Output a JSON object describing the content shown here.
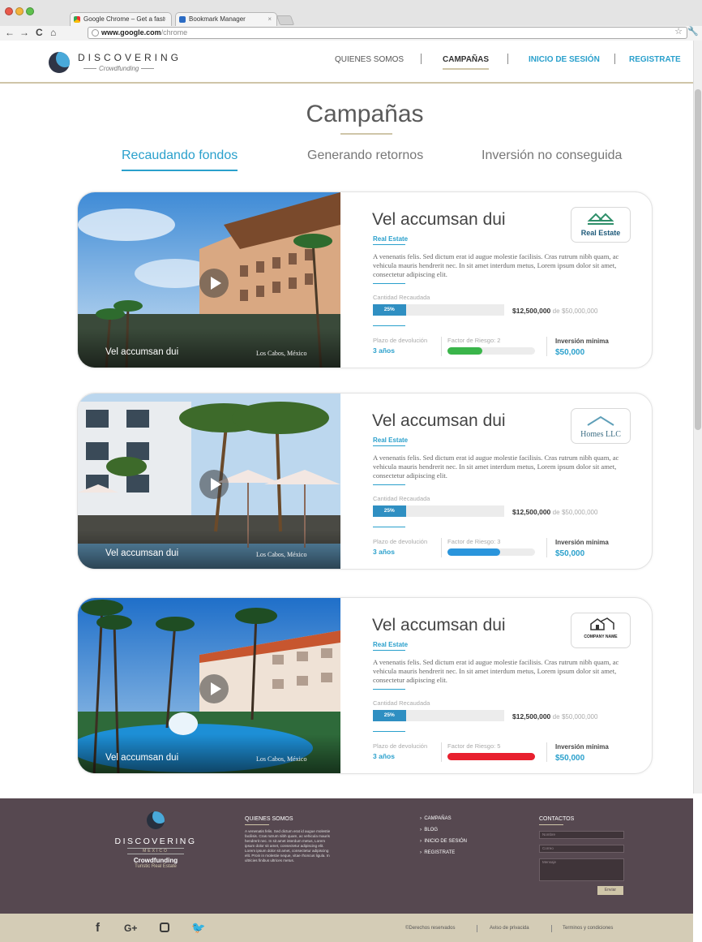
{
  "browser": {
    "tabs": [
      {
        "label": "Google Chrome – Get a fast"
      },
      {
        "label": "Bookmark Manager"
      }
    ],
    "url_host": "www.google.com",
    "url_path": "/chrome",
    "colors": {
      "red": "#e9584a",
      "yellow": "#f2b43a",
      "green": "#5ec14d"
    }
  },
  "header": {
    "logo_title": "DISCOVERING",
    "logo_sub": "Crowdfunding",
    "nav": {
      "about": "QUIENES SOMOS",
      "campaigns": "CAMPAÑAS",
      "login": "INICIO DE SESIÓN",
      "register": "REGISTRATE"
    }
  },
  "page": {
    "title": "Campañas",
    "tabs": {
      "raising": "Recaudando fondos",
      "returning": "Generando retornos",
      "failed": "Inversión no conseguida"
    }
  },
  "cards": [
    {
      "image_caption": "Vel accumsan dui",
      "image_location": "Los Cabos, México",
      "title": "Vel accumsan dui",
      "category": "Real Estate",
      "company_logo": "Real Estate",
      "description": "A venenatis felis. Sed dictum erat id augue molestie facilisis. Cras rutrum nibh quam, ac vehicula mauris hendrerit nec. In sit amet interdum metus, Lorem ipsum dolor sit amet, consectetur adipiscing elit.",
      "raised_label": "Cantidad Recaudada",
      "progress_label": "25%",
      "progress": 0.25,
      "raised": "$12,500,000",
      "of": "de",
      "goal": "$50,000,000",
      "term_label": "Plazo de devolución",
      "term": "3 años",
      "risk_label": "Factor de Riesgo: 2",
      "risk_level": 2,
      "risk_color": "#3ab54a",
      "min_label": "Inversión mínima",
      "min": "$50,000"
    },
    {
      "image_caption": "Vel accumsan dui",
      "image_location": "Los Cabos, México",
      "title": "Vel accumsan dui",
      "category": "Real Estate",
      "company_logo": "Homes LLC",
      "description": "A venenatis felis. Sed dictum erat id augue molestie facilisis. Cras rutrum nibh quam, ac vehicula mauris hendrerit nec. In sit amet interdum metus, Lorem ipsum dolor sit amet, consectetur adipiscing elit.",
      "raised_label": "Cantidad Recaudada",
      "progress_label": "25%",
      "progress": 0.25,
      "raised": "$12,500,000",
      "of": "de",
      "goal": "$50,000,000",
      "term_label": "Plazo de devolución",
      "term": "3 años",
      "risk_label": "Factor de Riesgo: 3",
      "risk_level": 3,
      "risk_color": "#2a95dc",
      "min_label": "Inversión mínima",
      "min": "$50,000"
    },
    {
      "image_caption": "Vel accumsan dui",
      "image_location": "Los Cabos, México",
      "title": "Vel accumsan dui",
      "category": "Real Estate",
      "company_logo": "COMPANY NAME",
      "description": "A venenatis felis. Sed dictum erat id augue molestie facilisis. Cras rutrum nibh quam, ac vehicula mauris hendrerit nec. In sit amet interdum metus, Lorem ipsum dolor sit amet, consectetur adipiscing elit.",
      "raised_label": "Cantidad Recaudada",
      "progress_label": "25%",
      "progress": 0.25,
      "raised": "$12,500,000",
      "of": "de",
      "goal": "$50,000,000",
      "term_label": "Plazo de devolución",
      "term": "3 años",
      "risk_label": "Factor de Riesgo: 5",
      "risk_level": 5,
      "risk_color": "#e8202e",
      "min_label": "Inversión mínima",
      "min": "$50,000"
    }
  ],
  "footer": {
    "logo_title": "DISCOVERING",
    "logo_country": "MÉXICO",
    "logo_sub": "Crowdfunding",
    "logo_tagline": "Turistic Real Estate",
    "about_heading": "QUIENES SOMOS",
    "about_text": "A venenatis felis. Sed dictum erat id augue molestie facilisis. Cras rutrum nibh quam, ac vehicula mauris hendrerit nec. In sit amet interdum metus, Lorem ipsum dolor sit amet, consectetur adipiscing elit. Lorem ipsum dolor sit amet, consectetur adipiscing elit. Proin in molestie neque, vitae rhoncus ligula. In ultricies finibus ultrices metus.",
    "links": [
      "CAMPAÑAS",
      "BLOG",
      "INICIO DE SESIÓN",
      "REGISTRATE"
    ],
    "contact_heading": "CONTACTOS",
    "fields": {
      "name": "Nombre",
      "email": "Correo",
      "message": "Mensaje"
    },
    "send": "Enviar",
    "legal": {
      "rights": "©Derechos reservados",
      "privacy": "Aviso de privacida",
      "terms": "Terminos y condiciones"
    },
    "social_icons": [
      "facebook-icon",
      "google-plus-icon",
      "instagram-icon",
      "twitter-icon"
    ]
  }
}
